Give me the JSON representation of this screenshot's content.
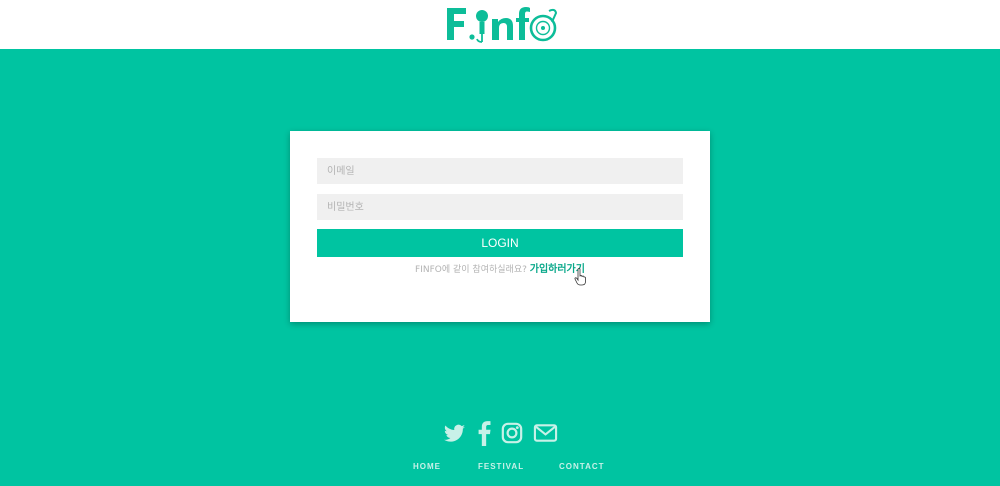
{
  "header": {
    "logo_text": "Finfo",
    "logo_color": "#0dbd99"
  },
  "login": {
    "email_placeholder": "이메일",
    "password_placeholder": "비밀번호",
    "button_label": "LOGIN",
    "signup_prompt": "FINFO에 같이 참여하실래요?",
    "signup_link": "가입하러가기"
  },
  "social": {
    "icons": [
      "twitter-icon",
      "facebook-icon",
      "instagram-icon",
      "mail-icon"
    ]
  },
  "footer_nav": {
    "home": "HOME",
    "festival": "FESTIVAL",
    "contact": "CONTACT"
  },
  "colors": {
    "background": "#00c4a1",
    "button": "#00c4a1",
    "card": "#ffffff",
    "field": "#f0f0f0"
  }
}
